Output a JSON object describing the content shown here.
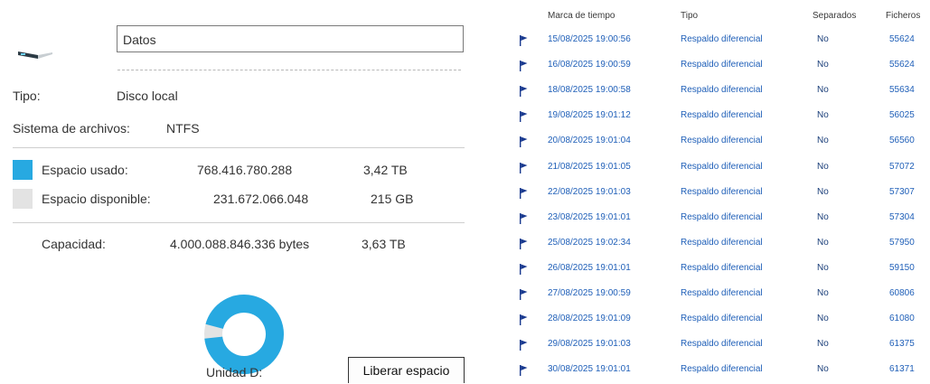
{
  "properties": {
    "name": "Datos",
    "type_label": "Tipo:",
    "type_value": "Disco local",
    "fs_label": "Sistema de archivos:",
    "fs_value": "NTFS",
    "used_label": "Espacio usado:",
    "used_bytes": "768.416.780.288",
    "used_size": "3,42 TB",
    "free_label": "Espacio disponible:",
    "free_bytes": "231.672.066.048",
    "free_size": "215 GB",
    "capacity_label": "Capacidad:",
    "capacity_bytes": "4.000.088.846.336 bytes",
    "capacity_size": "3,63 TB",
    "drive_label": "Unidad D:",
    "free_space_button": "Liberar espacio",
    "used_fraction": 0.94,
    "colors": {
      "used": "#27a9e1",
      "free": "#e3e3e3"
    }
  },
  "history": {
    "headers": {
      "timestamp": "Marca de tiempo",
      "type": "Tipo",
      "separated": "Separados",
      "files": "Ficheros"
    },
    "rows": [
      {
        "timestamp": "15/08/2025 19:00:56",
        "type": "Respaldo diferencial",
        "separated": "No",
        "files": "55624"
      },
      {
        "timestamp": "16/08/2025 19:00:59",
        "type": "Respaldo diferencial",
        "separated": "No",
        "files": "55624"
      },
      {
        "timestamp": "18/08/2025 19:00:58",
        "type": "Respaldo diferencial",
        "separated": "No",
        "files": "55634"
      },
      {
        "timestamp": "19/08/2025 19:01:12",
        "type": "Respaldo diferencial",
        "separated": "No",
        "files": "56025"
      },
      {
        "timestamp": "20/08/2025 19:01:04",
        "type": "Respaldo diferencial",
        "separated": "No",
        "files": "56560"
      },
      {
        "timestamp": "21/08/2025 19:01:05",
        "type": "Respaldo diferencial",
        "separated": "No",
        "files": "57072"
      },
      {
        "timestamp": "22/08/2025 19:01:03",
        "type": "Respaldo diferencial",
        "separated": "No",
        "files": "57307"
      },
      {
        "timestamp": "23/08/2025 19:01:01",
        "type": "Respaldo diferencial",
        "separated": "No",
        "files": "57304"
      },
      {
        "timestamp": "25/08/2025 19:02:34",
        "type": "Respaldo diferencial",
        "separated": "No",
        "files": "57950"
      },
      {
        "timestamp": "26/08/2025 19:01:01",
        "type": "Respaldo diferencial",
        "separated": "No",
        "files": "59150"
      },
      {
        "timestamp": "27/08/2025 19:00:59",
        "type": "Respaldo diferencial",
        "separated": "No",
        "files": "60806"
      },
      {
        "timestamp": "28/08/2025 19:01:09",
        "type": "Respaldo diferencial",
        "separated": "No",
        "files": "61080"
      },
      {
        "timestamp": "29/08/2025 19:01:03",
        "type": "Respaldo diferencial",
        "separated": "No",
        "files": "61375"
      },
      {
        "timestamp": "30/08/2025 19:01:01",
        "type": "Respaldo diferencial",
        "separated": "No",
        "files": "61371"
      }
    ],
    "colors": {
      "link": "#1f5fb8",
      "flag": "#1a3a8f"
    },
    "row_icon": "flag-icon"
  }
}
